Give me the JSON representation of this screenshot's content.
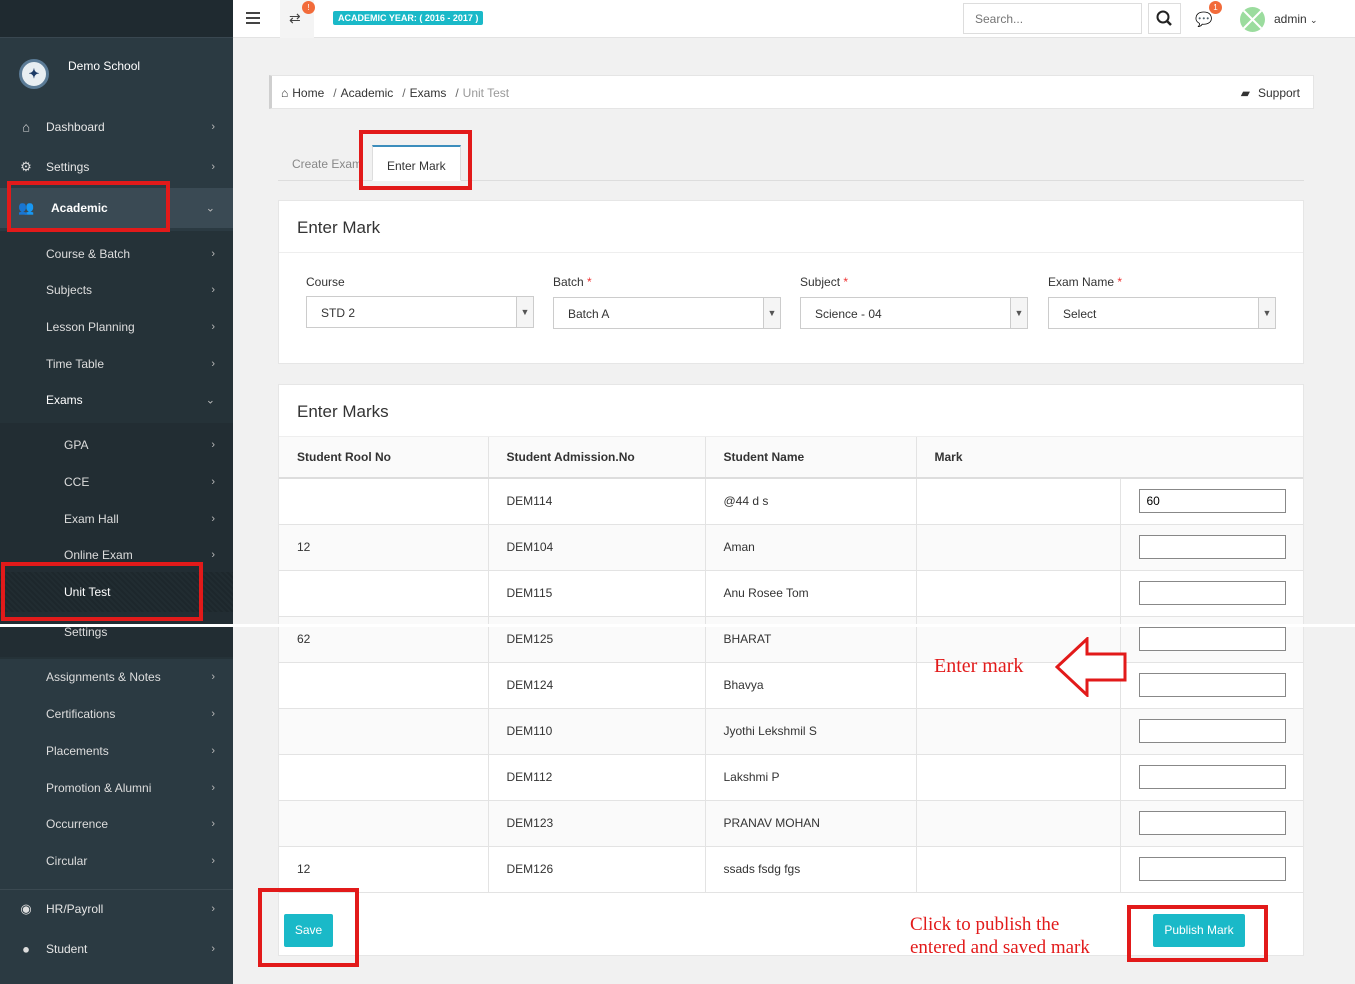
{
  "sidebar": {
    "school_name": "Demo School",
    "items": [
      {
        "label": "Dashboard",
        "icon": "home-icon"
      },
      {
        "label": "Settings",
        "icon": "gears-icon"
      },
      {
        "label": "Academic",
        "icon": "users-icon"
      }
    ],
    "academic_sub": [
      {
        "label": "Course & Batch"
      },
      {
        "label": "Subjects"
      },
      {
        "label": "Lesson Planning"
      },
      {
        "label": "Time Table"
      },
      {
        "label": "Exams"
      }
    ],
    "exam_sub": [
      {
        "label": "GPA"
      },
      {
        "label": "CCE"
      },
      {
        "label": "Exam Hall"
      },
      {
        "label": "Online Exam"
      },
      {
        "label": "Unit Test"
      },
      {
        "label": "Settings"
      }
    ],
    "more_sub": [
      {
        "label": "Assignments & Notes"
      },
      {
        "label": "Certifications"
      },
      {
        "label": "Placements"
      },
      {
        "label": "Promotion & Alumni"
      },
      {
        "label": "Occurrence"
      },
      {
        "label": "Circular"
      }
    ],
    "bottom_items": [
      {
        "label": "HR/Payroll",
        "icon": "eye-icon"
      },
      {
        "label": "Student",
        "icon": "user-icon"
      }
    ]
  },
  "topbar": {
    "sync_badge": "!",
    "academic_year": "ACADEMIC YEAR: ( 2016 - 2017 )",
    "search_placeholder": "Search...",
    "chat_badge": "1",
    "user": "admin"
  },
  "breadcrumb": {
    "items": [
      "Home",
      "Academic",
      "Exams",
      "Unit Test"
    ],
    "support": "Support"
  },
  "tabs": [
    "Create Exam",
    "Enter Mark"
  ],
  "filter_panel": {
    "title": "Enter Mark",
    "fields": [
      {
        "label": "Course",
        "required": "",
        "value": "STD 2"
      },
      {
        "label": "Batch",
        "required": "*",
        "value": "Batch A"
      },
      {
        "label": "Subject",
        "required": "*",
        "value": "Science - 04"
      },
      {
        "label": "Exam Name",
        "required": "*",
        "value": "Select"
      }
    ]
  },
  "marks_panel": {
    "title": "Enter Marks",
    "columns": [
      "Student Rool No",
      "Student Admission.No",
      "Student Name",
      "Mark"
    ],
    "rows": [
      {
        "roll": "",
        "adm": "DEM114",
        "name": "@44 d s",
        "mark": "60"
      },
      {
        "roll": "12",
        "adm": "DEM104",
        "name": "Aman",
        "mark": ""
      },
      {
        "roll": "",
        "adm": "DEM115",
        "name": "Anu Rosee Tom",
        "mark": ""
      },
      {
        "roll": "62",
        "adm": "DEM125",
        "name": "BHARAT",
        "mark": ""
      },
      {
        "roll": "",
        "adm": "DEM124",
        "name": "Bhavya",
        "mark": ""
      },
      {
        "roll": "",
        "adm": "DEM110",
        "name": "Jyothi Lekshmil S",
        "mark": ""
      },
      {
        "roll": "",
        "adm": "DEM112",
        "name": "Lakshmi P",
        "mark": ""
      },
      {
        "roll": "",
        "adm": "DEM123",
        "name": "PRANAV MOHAN",
        "mark": ""
      },
      {
        "roll": "12",
        "adm": "DEM126",
        "name": "ssads fsdg fgs",
        "mark": ""
      }
    ],
    "save_label": "Save",
    "publish_label": "Publish Mark"
  },
  "annotations": {
    "enter_mark": "Enter mark",
    "publish_line1": "Click to publish the",
    "publish_line2": "entered and saved mark",
    "color": "#e21a1a"
  },
  "colors": {
    "accent": "#1ab9c8",
    "sidebar": "#2b3a42",
    "badge": "#f26b3a"
  }
}
